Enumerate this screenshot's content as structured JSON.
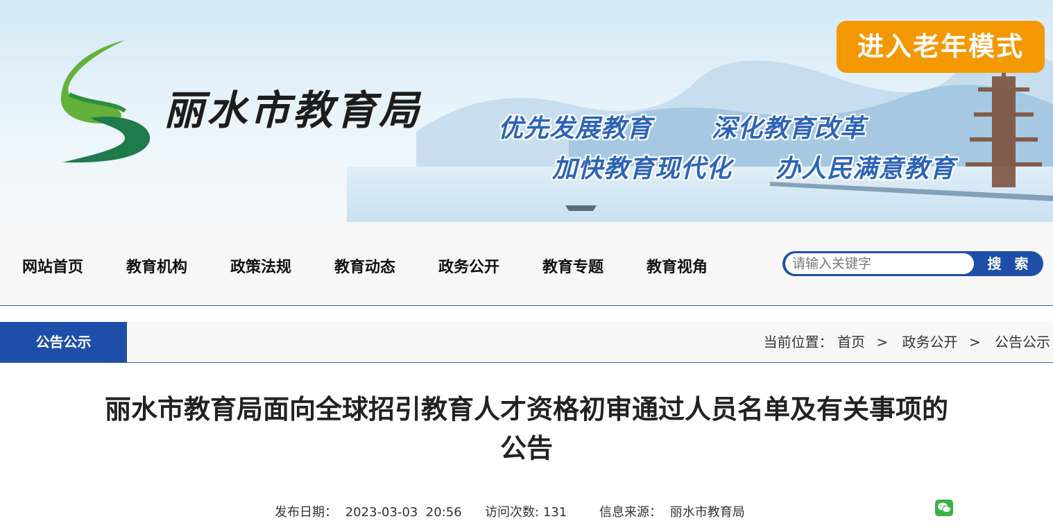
{
  "header": {
    "logo_text": "丽水市教育局",
    "slogans": [
      "优先发展教育",
      "深化教育改革",
      "加快教育现代化",
      "办人民满意教育"
    ],
    "elder_mode_label": "进入老年模式"
  },
  "nav": {
    "items": [
      "网站首页",
      "教育机构",
      "政策法规",
      "教育动态",
      "政务公开",
      "教育专题",
      "教育视角"
    ],
    "search_placeholder": "请输入关键字",
    "search_button": "搜 索"
  },
  "section": {
    "tab_label": "公告公示",
    "breadcrumb": {
      "prefix": "当前位置：",
      "items": [
        "首页",
        "政务公开",
        "公告公示"
      ],
      "separator": ">"
    }
  },
  "article": {
    "title_line1": "丽水市教育局面向全球招引教育人才资格初审通过人员名单及有关事项的",
    "title_line2": "公告",
    "publish_label": "发布日期：",
    "publish_date": "2023-03-03  20:56",
    "visits_label": "访问次数:",
    "visits": "131",
    "source_label": "信息来源：",
    "source": "丽水市教育局"
  },
  "icons": {
    "logo": "lishui-s-logo",
    "share": "wechat-icon"
  },
  "colors": {
    "primary_blue": "#1e4ea8",
    "accent_orange": "#f39800",
    "slogan_blue": "#2d64b8",
    "wechat_green": "#38b249"
  }
}
